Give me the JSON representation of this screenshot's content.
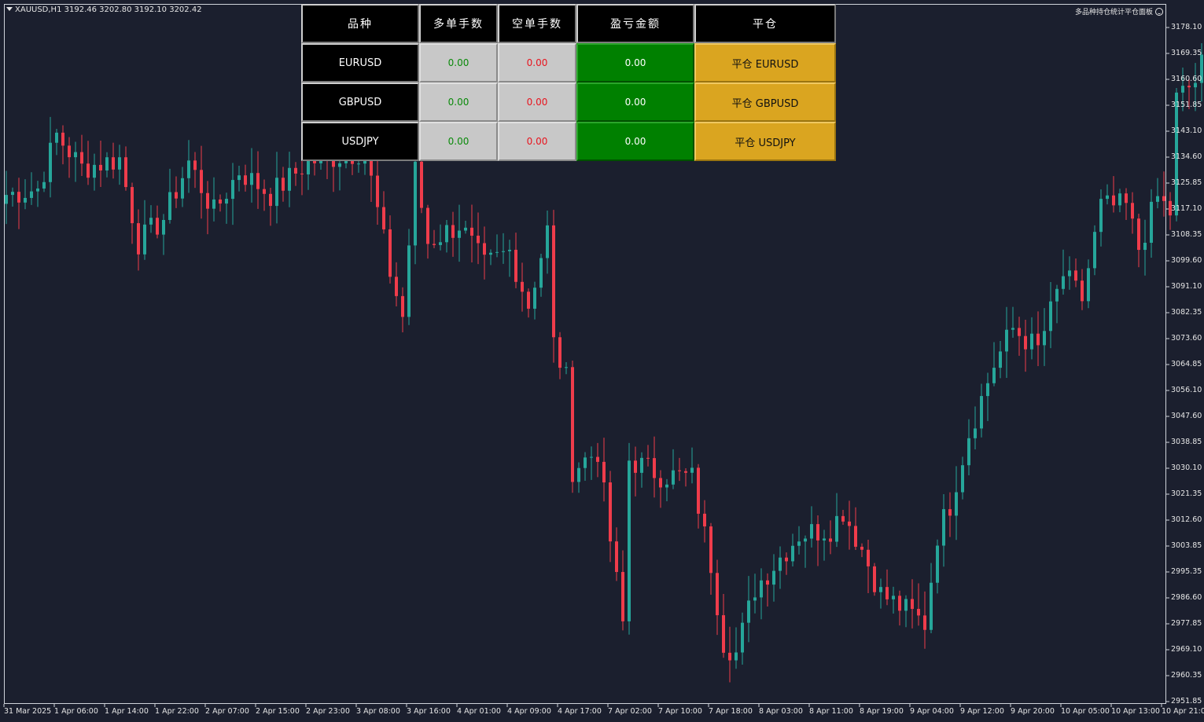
{
  "header": {
    "symbol_info": "XAUUSD,H1  3192.46 3202.80 3192.10 3202.42",
    "indicator_name": "多品种持仓统计平仓面板"
  },
  "colors": {
    "background": "#1b1f2e",
    "bull": "#26a69a",
    "bear": "#ef3c4b",
    "panel_header": "#000000",
    "panel_lots": "#c8c8c8",
    "panel_pnl": "#008000",
    "panel_close": "#daa520"
  },
  "panel": {
    "columns": [
      "品种",
      "多单手数",
      "空单手数",
      "盈亏金额",
      "平仓"
    ],
    "rows": [
      {
        "symbol": "EURUSD",
        "long_lots": "0.00",
        "short_lots": "0.00",
        "pnl": "0.00",
        "close_label": "平仓 EURUSD"
      },
      {
        "symbol": "GBPUSD",
        "long_lots": "0.00",
        "short_lots": "0.00",
        "pnl": "0.00",
        "close_label": "平仓 GBPUSD"
      },
      {
        "symbol": "USDJPY",
        "long_lots": "0.00",
        "short_lots": "0.00",
        "pnl": "0.00",
        "close_label": "平仓 USDJPY"
      }
    ]
  },
  "chart_data": {
    "type": "candlestick",
    "symbol": "XAUUSD",
    "timeframe": "H1",
    "ylim": [
      2948.0,
      3183.0
    ],
    "price_ticks": [
      "3178.10",
      "3169.35",
      "3160.60",
      "3151.85",
      "3143.10",
      "3134.60",
      "3125.85",
      "3117.10",
      "3108.35",
      "3099.60",
      "3091.10",
      "3082.35",
      "3073.60",
      "3064.85",
      "3056.10",
      "3047.60",
      "3038.85",
      "3030.10",
      "3021.35",
      "3012.60",
      "3003.85",
      "2995.35",
      "2986.60",
      "2977.85",
      "2969.10",
      "2960.35",
      "2951.85"
    ],
    "time_ticks": [
      "31 Mar 2025",
      "1 Apr 06:00",
      "1 Apr 14:00",
      "1 Apr 22:00",
      "2 Apr 07:00",
      "2 Apr 15:00",
      "2 Apr 23:00",
      "3 Apr 08:00",
      "3 Apr 16:00",
      "4 Apr 01:00",
      "4 Apr 09:00",
      "4 Apr 17:00",
      "7 Apr 02:00",
      "7 Apr 10:00",
      "7 Apr 18:00",
      "8 Apr 03:00",
      "8 Apr 11:00",
      "8 Apr 19:00",
      "9 Apr 04:00",
      "9 Apr 12:00",
      "9 Apr 20:00",
      "10 Apr 05:00",
      "10 Apr 13:00",
      "10 Apr 21:00"
    ],
    "anchors": [
      {
        "bar": 0,
        "price": 3122
      },
      {
        "bar": 5,
        "price": 3124
      },
      {
        "bar": 8,
        "price": 3142
      },
      {
        "bar": 12,
        "price": 3131
      },
      {
        "bar": 18,
        "price": 3134
      },
      {
        "bar": 21,
        "price": 3106
      },
      {
        "bar": 25,
        "price": 3114
      },
      {
        "bar": 29,
        "price": 3133
      },
      {
        "bar": 33,
        "price": 3116
      },
      {
        "bar": 37,
        "price": 3130
      },
      {
        "bar": 42,
        "price": 3122
      },
      {
        "bar": 48,
        "price": 3133
      },
      {
        "bar": 53,
        "price": 3135
      },
      {
        "bar": 57,
        "price": 3137
      },
      {
        "bar": 61,
        "price": 3096
      },
      {
        "bar": 63,
        "price": 3081
      },
      {
        "bar": 65,
        "price": 3130
      },
      {
        "bar": 67,
        "price": 3106
      },
      {
        "bar": 72,
        "price": 3112
      },
      {
        "bar": 76,
        "price": 3098
      },
      {
        "bar": 80,
        "price": 3103
      },
      {
        "bar": 83,
        "price": 3085
      },
      {
        "bar": 86,
        "price": 3110
      },
      {
        "bar": 87,
        "price": 3072
      },
      {
        "bar": 89,
        "price": 3060
      },
      {
        "bar": 90,
        "price": 3030
      },
      {
        "bar": 94,
        "price": 3036
      },
      {
        "bar": 96,
        "price": 3006
      },
      {
        "bar": 98,
        "price": 2978
      },
      {
        "bar": 99,
        "price": 3033
      },
      {
        "bar": 104,
        "price": 3028
      },
      {
        "bar": 109,
        "price": 3027
      },
      {
        "bar": 112,
        "price": 2998
      },
      {
        "bar": 114,
        "price": 2972
      },
      {
        "bar": 116,
        "price": 2968
      },
      {
        "bar": 119,
        "price": 2990
      },
      {
        "bar": 126,
        "price": 3008
      },
      {
        "bar": 131,
        "price": 3010
      },
      {
        "bar": 133,
        "price": 3016
      },
      {
        "bar": 136,
        "price": 3003
      },
      {
        "bar": 139,
        "price": 2988
      },
      {
        "bar": 144,
        "price": 2981
      },
      {
        "bar": 146,
        "price": 2978
      },
      {
        "bar": 148,
        "price": 3008
      },
      {
        "bar": 150,
        "price": 3018
      },
      {
        "bar": 153,
        "price": 3042
      },
      {
        "bar": 157,
        "price": 3065
      },
      {
        "bar": 160,
        "price": 3077
      },
      {
        "bar": 164,
        "price": 3070
      },
      {
        "bar": 168,
        "price": 3095
      },
      {
        "bar": 171,
        "price": 3087
      },
      {
        "bar": 174,
        "price": 3118
      },
      {
        "bar": 178,
        "price": 3118
      },
      {
        "bar": 180,
        "price": 3104
      },
      {
        "bar": 183,
        "price": 3121
      },
      {
        "bar": 185,
        "price": 3116
      },
      {
        "bar": 186,
        "price": 3154
      },
      {
        "bar": 189,
        "price": 3160
      },
      {
        "bar": 190,
        "price": 3169
      }
    ]
  }
}
